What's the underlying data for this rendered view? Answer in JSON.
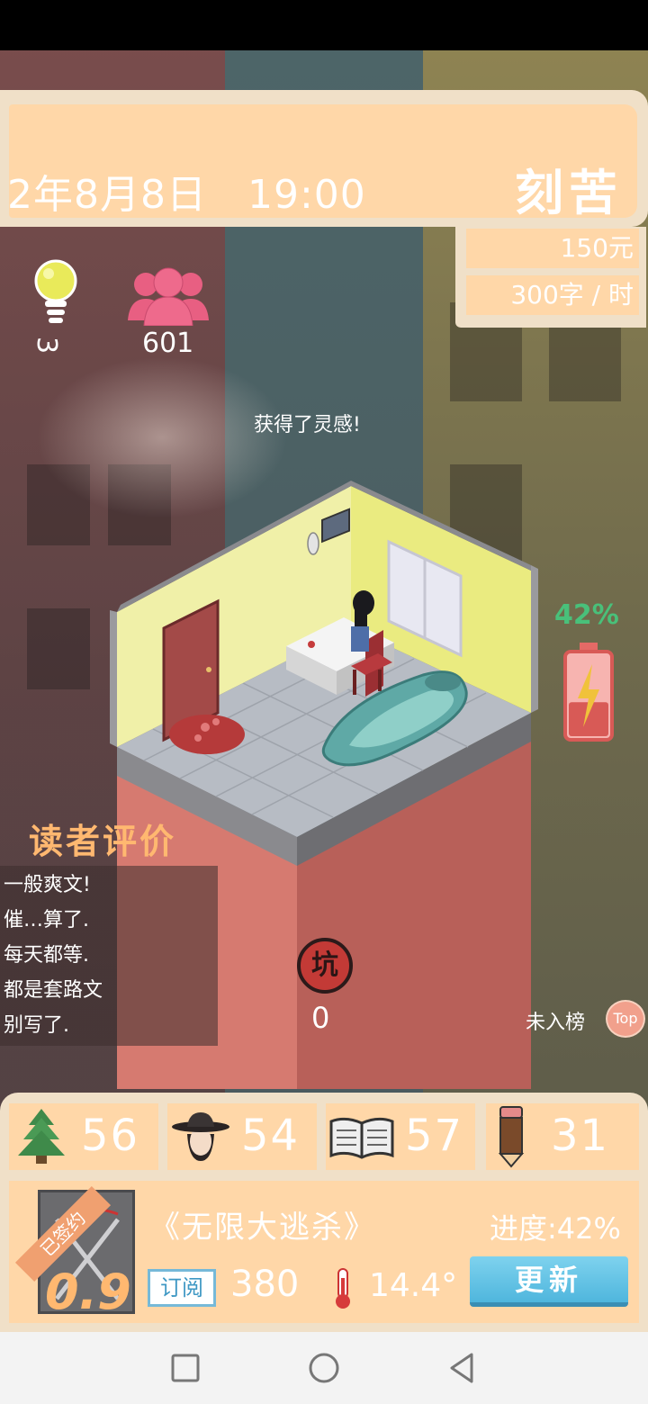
{
  "header": {
    "date": "2年8月8日",
    "time": "19:00",
    "mood": "刻苦",
    "money": "150元",
    "speed": "300字 / 时"
  },
  "stats": {
    "inspiration": "3",
    "fans": "601"
  },
  "notification": "获得了灵感!",
  "battery": {
    "percent_label": "42%",
    "level": 0.42,
    "color": "#49c07a"
  },
  "reviews": {
    "title": "读者评价",
    "lines": [
      "一般爽文!",
      "催…算了.",
      "每天都等.",
      "都是套路文",
      "别写了."
    ]
  },
  "pit": {
    "label": "坑",
    "count": "0"
  },
  "ranking": {
    "label": "未入榜",
    "badge": "Top"
  },
  "attributes": [
    {
      "icon": "tree-icon",
      "value": "56"
    },
    {
      "icon": "hat-avatar-icon",
      "value": "54"
    },
    {
      "icon": "book-icon",
      "value": "57"
    },
    {
      "icon": "pencil-icon",
      "value": "31"
    }
  ],
  "book": {
    "signed_label": "已签约",
    "rating": "0.9",
    "title": "《无限大逃杀》",
    "progress": "进度:42%",
    "subscription_label": "订阅",
    "subscription_count": "380",
    "heat": "14.4°",
    "update_label": "更新"
  },
  "colors": {
    "panel": "#ffd7a8",
    "panel_border": "#f0e0c8",
    "accent_orange": "#ffb870",
    "button_blue": "#4fb6dd"
  }
}
